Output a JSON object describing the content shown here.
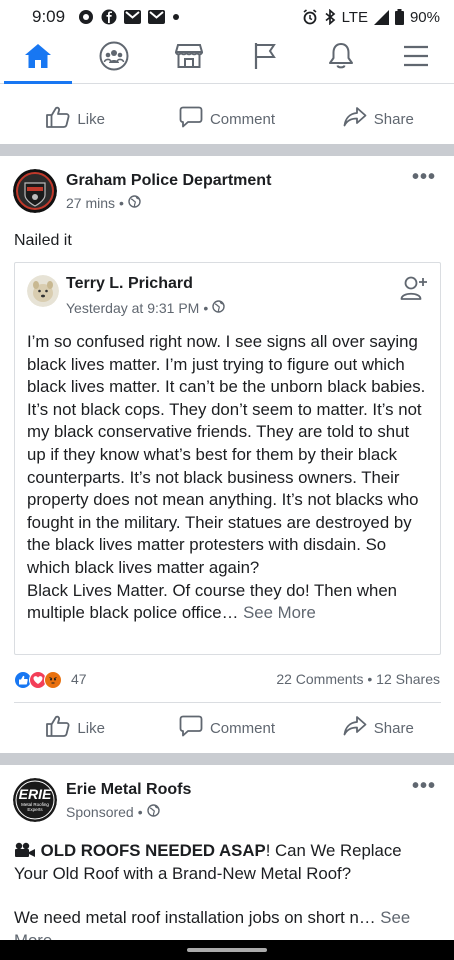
{
  "status_bar": {
    "time": "9:09",
    "network": "LTE",
    "battery": "90%"
  },
  "nav": {
    "tabs": [
      {
        "name": "home-icon",
        "active": true
      },
      {
        "name": "groups-icon",
        "active": false
      },
      {
        "name": "marketplace-icon",
        "active": false
      },
      {
        "name": "pages-flag-icon",
        "active": false
      },
      {
        "name": "notifications-bell-icon",
        "active": false
      },
      {
        "name": "menu-icon",
        "active": false
      }
    ],
    "accent_color": "#1877f2"
  },
  "top_actions": {
    "like": "Like",
    "comment": "Comment",
    "share": "Share"
  },
  "post": {
    "author": "Graham Police Department",
    "time": "27 mins",
    "text": "Nailed it",
    "shared": {
      "author": "Terry L. Prichard",
      "time": "Yesterday at 9:31 PM",
      "body": "I’m so confused right now. I see signs all over saying black lives matter. I’m just trying to figure out which black lives matter. It can’t be the unborn black babies. It’s not black cops. They don’t seem to matter. It’s not my black conservative friends. They are told to shut up if they know what’s best for them by their black counterparts. It’s not black business owners. Their property does not mean anything. It’s not blacks who fought in the military. Their statues are destroyed by the black lives matter protesters with disdain. So which black lives matter again?",
      "body2": "Black Lives Matter. Of course they do! Then when multiple black police office…",
      "see_more": "See More"
    },
    "reaction_count": "47",
    "comments": "22 Comments",
    "shares": "12 Shares",
    "actions": {
      "like": "Like",
      "comment": "Comment",
      "share": "Share"
    }
  },
  "ad": {
    "author": "Erie Metal Roofs",
    "sponsored": "Sponsored",
    "logo_text": "ERIE",
    "logo_subtext": "Metal Roofing Experts",
    "headline_bold": "OLD ROOFS NEEDED ASAP",
    "headline_rest": "! Can We Replace Your Old Roof with a Brand-New Metal Roof?",
    "body": "We need metal roof installation jobs on short n…",
    "see_more": "See More"
  }
}
